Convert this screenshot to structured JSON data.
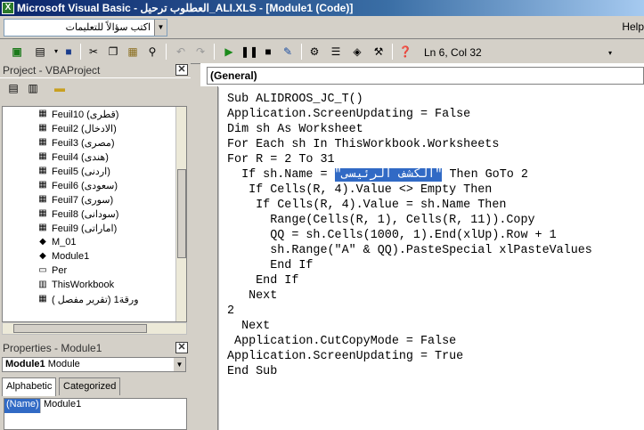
{
  "window": {
    "title": "Microsoft Visual Basic - العطلوب ترحيل_ALI.XLS - [Module1 (Code)]"
  },
  "menubar": {
    "ask_placeholder": "اكتب سؤالاً للتعليمات",
    "help_label": "Help"
  },
  "toolbar": {
    "position_text": "Ln 6, Col 32"
  },
  "project_panel": {
    "title": "Project - VBAProject",
    "items": [
      {
        "label": "Feuil10 (قطرى)",
        "icon": "worksheet-icon"
      },
      {
        "label": "Feuil2 (الادخال)",
        "icon": "worksheet-icon"
      },
      {
        "label": "Feuil3 (مصرى)",
        "icon": "worksheet-icon"
      },
      {
        "label": "Feuil4 (هندى)",
        "icon": "worksheet-icon"
      },
      {
        "label": "Feuil5 (اردنى)",
        "icon": "worksheet-icon"
      },
      {
        "label": "Feuil6 (سعودى)",
        "icon": "worksheet-icon"
      },
      {
        "label": "Feuil7 (سورى)",
        "icon": "worksheet-icon"
      },
      {
        "label": "Feuil8 (سودانى)",
        "icon": "worksheet-icon"
      },
      {
        "label": "Feuil9 (اماراتى)",
        "icon": "worksheet-icon"
      },
      {
        "label": "M_01",
        "icon": "module-icon"
      },
      {
        "label": "Module1",
        "icon": "module-icon"
      },
      {
        "label": "Per",
        "icon": "form-icon"
      },
      {
        "label": "ThisWorkbook",
        "icon": "workbook-icon"
      },
      {
        "label": "ورقة1 (تقرير مفصل )",
        "icon": "worksheet-icon"
      }
    ]
  },
  "properties_panel": {
    "title": "Properties - Module1",
    "object_name": "Module1",
    "object_type": "Module",
    "tabs": [
      "Alphabetic",
      "Categorized"
    ],
    "rows": [
      {
        "name": "(Name)",
        "value": "Module1"
      }
    ]
  },
  "code_window": {
    "object_dropdown": "(General)",
    "selected_text": "\"الكشف الرئيسى\"",
    "lines": [
      "Sub ALIDROOS_JC_T()",
      "Application.ScreenUpdating = False",
      "Dim sh As Worksheet",
      "For Each sh In ThisWorkbook.Worksheets",
      "For R = 2 To 31",
      "  If sh.Name = ",
      "   If Cells(R, 4).Value <> Empty Then",
      "    If Cells(R, 4).Value = sh.Name Then",
      "      Range(Cells(R, 1), Cells(R, 11)).Copy",
      "      QQ = sh.Cells(1000, 1).End(xlUp).Row + 1",
      "      sh.Range(\"A\" & QQ).PasteSpecial xlPasteValues",
      "      End If",
      "    End If",
      "   Next",
      "2",
      "  Next",
      " Application.CutCopyMode = False",
      "Application.ScreenUpdating = True",
      "End Sub"
    ],
    "line6_suffix": " Then GoTo 2"
  }
}
